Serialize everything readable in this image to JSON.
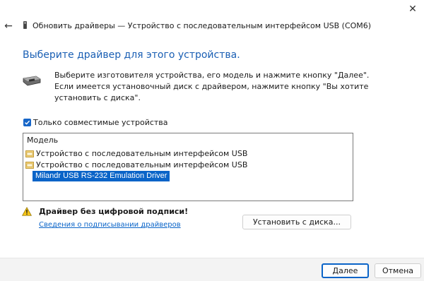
{
  "window": {
    "title": "Обновить драйверы — Устройство с последовательным интерфейсом USB (COM6)",
    "close_glyph": "✕",
    "back_glyph": "←"
  },
  "heading": "Выберите драйвер для этого устройства.",
  "instructions": "Выберите изготовителя устройства, его модель и нажмите кнопку \"Далее\". Если имеется установочный диск с драйвером, нажмите кнопку \"Вы хотите установить с диска\".",
  "compatible_only": {
    "label": "Только совместимые устройства",
    "checked": true
  },
  "model_list": {
    "header": "Модель",
    "items": [
      {
        "label": "Устройство с последовательным интерфейсом USB",
        "icon": "driver-package-icon",
        "selected": false
      },
      {
        "label": "Устройство с последовательным интерфейсом USB",
        "icon": "driver-package-icon",
        "selected": false
      },
      {
        "label": "Milandr USB RS-232 Emulation Driver",
        "icon": "",
        "selected": true
      }
    ]
  },
  "warning": {
    "text": "Драйвер без цифровой подписи!",
    "link": "Сведения о подписывании драйверов",
    "icon": "warning-icon"
  },
  "buttons": {
    "install_from_disk": "Установить с диска...",
    "next": "Далее",
    "cancel": "Отмена"
  },
  "colors": {
    "accent": "#0a64c8",
    "heading": "#1a5fb4",
    "footer_bg": "#f3f3f3"
  }
}
